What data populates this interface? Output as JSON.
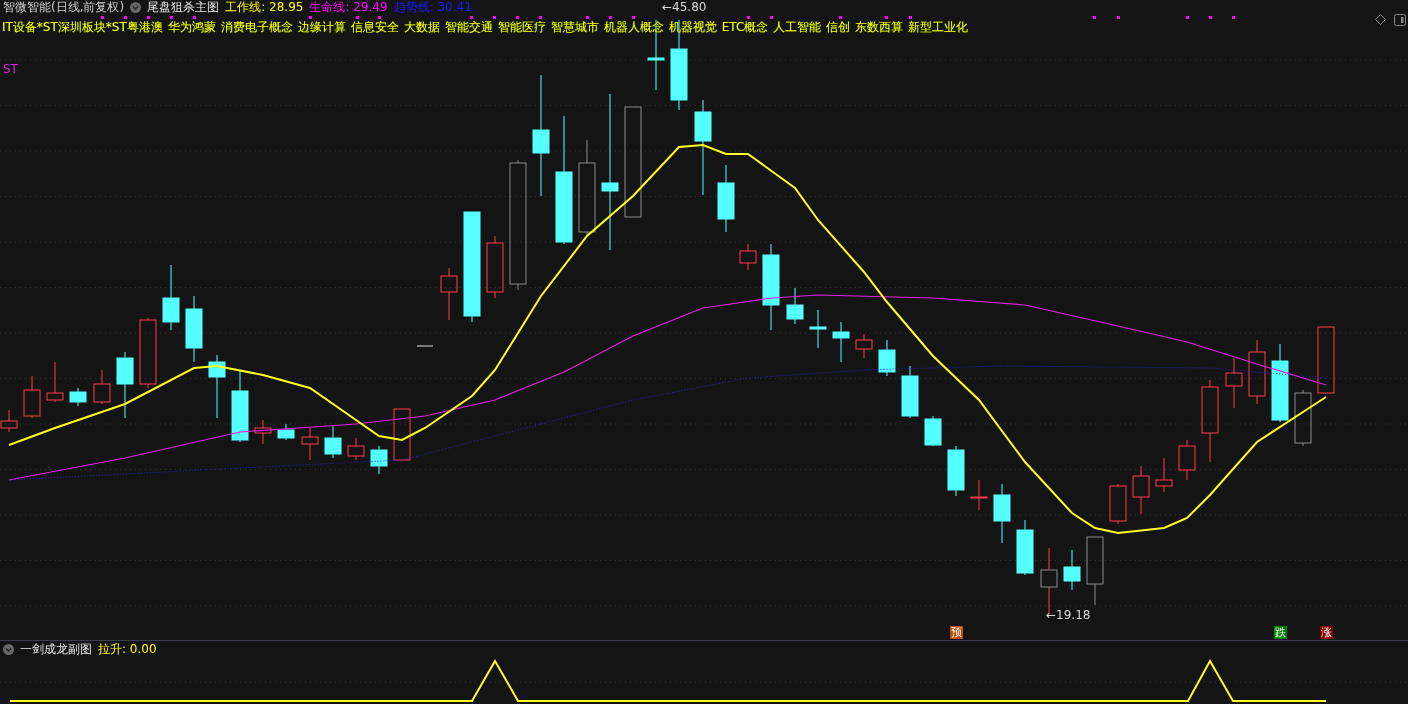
{
  "header": {
    "stock": "智微智能(日线,前复权)",
    "main_indicator": "尾盘狙杀主图",
    "indicators": [
      {
        "label": "工作线: 28.95",
        "color": "#ffff00"
      },
      {
        "label": "生命线: 29.49",
        "color": "#ff00ff"
      },
      {
        "label": "趋势线: 30.41",
        "color": "#1a1aff"
      }
    ]
  },
  "concepts": [
    "IT设备*ST深圳板块*ST粤港澳",
    "华为鸿蒙",
    "消费电子概念",
    "边缘计算",
    "信息安全",
    "大数据",
    "智能交通",
    "智能医疗",
    "智慧城市",
    "机器人概念",
    "机器视觉",
    "ETC概念",
    "人工智能",
    "信创",
    "东数西算",
    "新型工业化"
  ],
  "chart": {
    "st_label": "ST",
    "high_label": "←45.80",
    "low_label": "←19.18",
    "signals": [
      {
        "label": "预",
        "color": "#c04a00"
      },
      {
        "label": "跌",
        "color": "#008000"
      },
      {
        "label": "涨",
        "color": "#800000"
      }
    ]
  },
  "sub_chart": {
    "title": "一剑成龙副图",
    "reading": "拉升: 0.00"
  }
}
